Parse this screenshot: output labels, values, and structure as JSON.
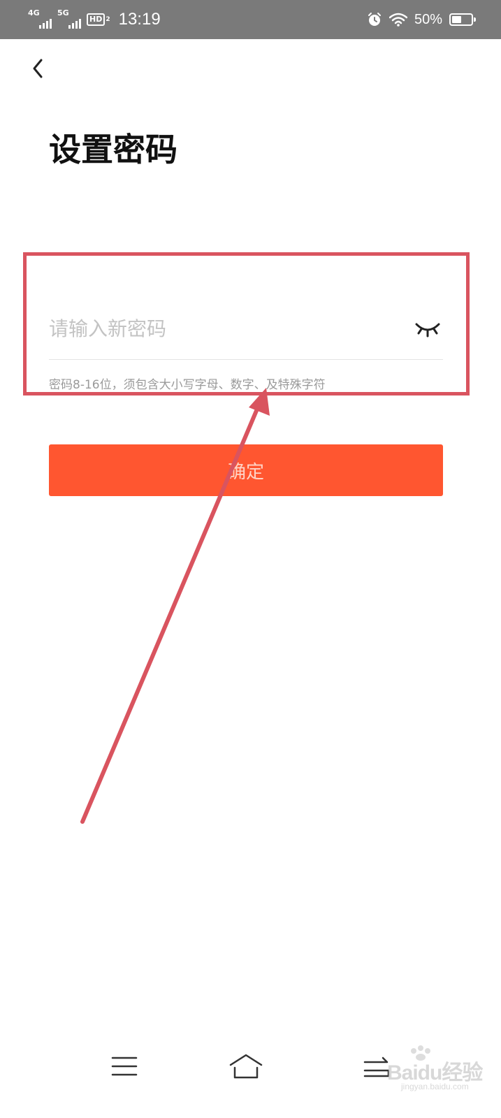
{
  "status_bar": {
    "network_1": "4G",
    "network_2": "5G",
    "hd_label": "HD",
    "hd_sub": "2",
    "time": "13:19",
    "battery_percent": "50%",
    "battery_level": 0.5,
    "icons": [
      "signal-icon",
      "signal-icon",
      "hd-voice-icon",
      "alarm-icon",
      "wifi-icon",
      "battery-icon"
    ]
  },
  "page": {
    "title": "设置密码",
    "back_icon": "chevron-left-icon"
  },
  "password_field": {
    "placeholder": "请输入新密码",
    "value": "",
    "visibility_icon": "eye-closed-icon"
  },
  "hint": "密码8-16位，须包含大小写字母、数字、及特殊字符",
  "confirm_button": {
    "label": "确定"
  },
  "nav_bar": {
    "icons": [
      "menu-icon",
      "home-icon",
      "back-nav-icon"
    ]
  },
  "watermark": {
    "text": "Baidu经验",
    "subtext": "jingyan.baidu.com"
  },
  "colors": {
    "status_bar_bg": "#7a7a7a",
    "accent": "#ff5630",
    "annotation": "#d9545f",
    "placeholder": "#c3c3c3",
    "hint": "#9a9a9a"
  }
}
